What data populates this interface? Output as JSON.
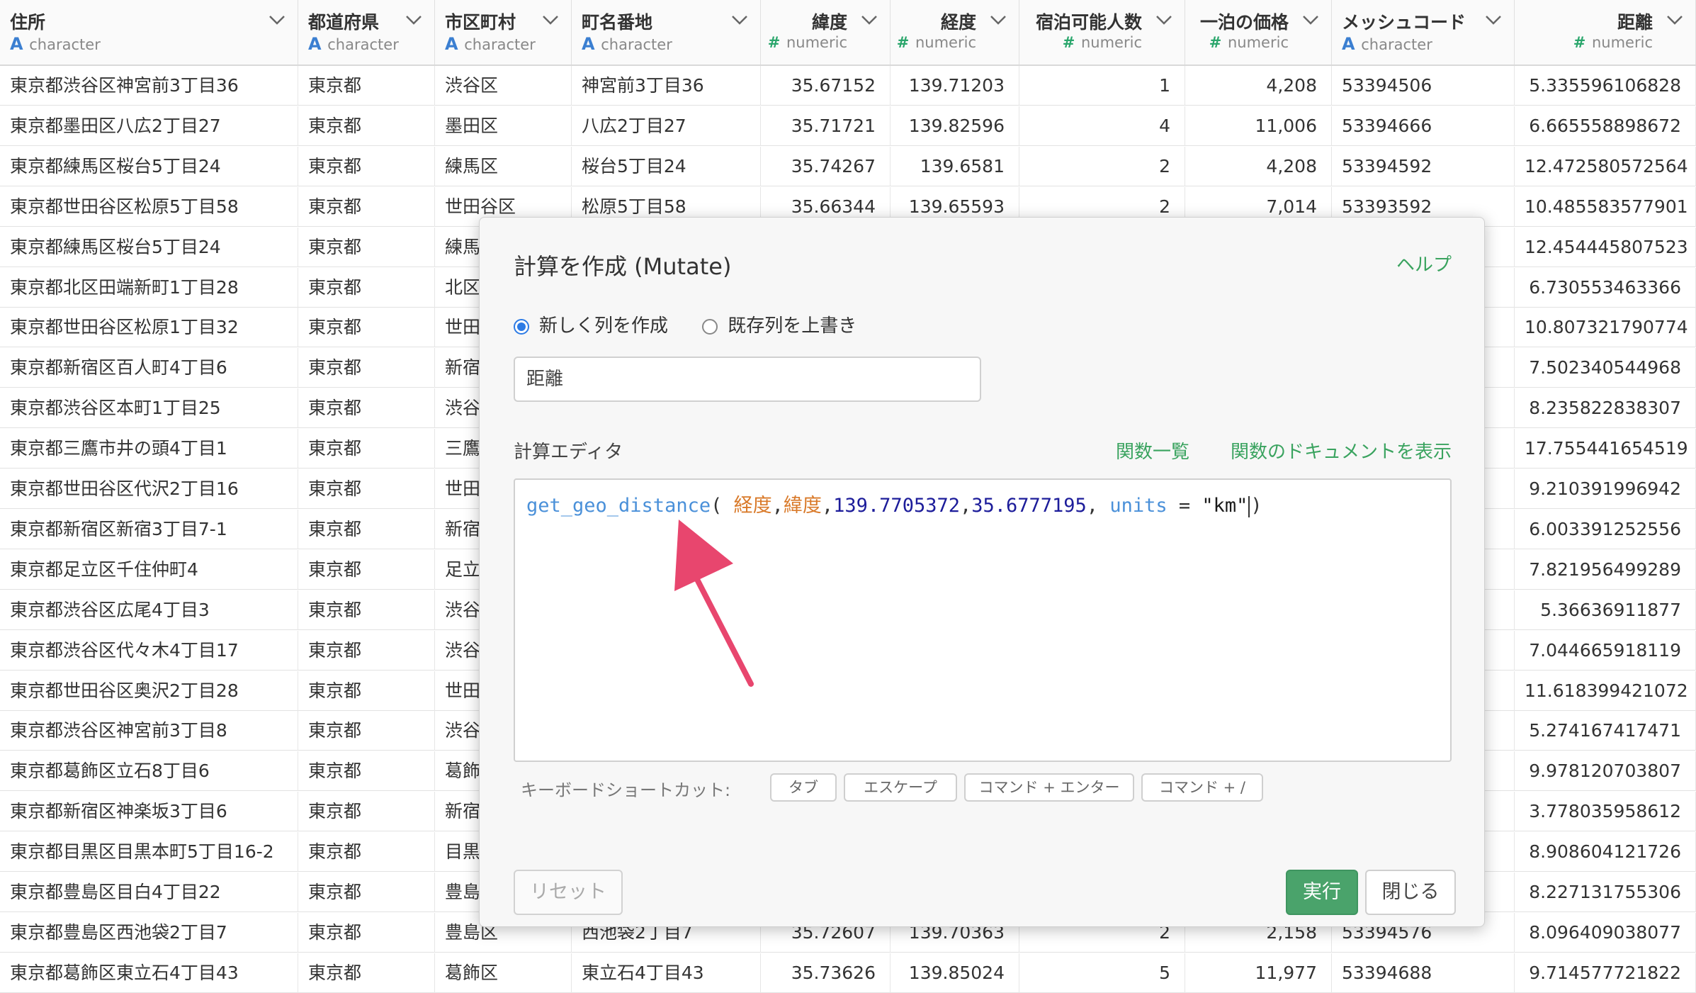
{
  "columns": [
    {
      "name": "住所",
      "type": "character"
    },
    {
      "name": "都道府県",
      "type": "character"
    },
    {
      "name": "市区町村",
      "type": "character"
    },
    {
      "name": "町名番地",
      "type": "character"
    },
    {
      "name": "緯度",
      "type": "numeric"
    },
    {
      "name": "経度",
      "type": "numeric"
    },
    {
      "name": "宿泊可能人数",
      "type": "numeric"
    },
    {
      "name": "一泊の価格",
      "type": "numeric"
    },
    {
      "name": "メッシュコード",
      "type": "character"
    },
    {
      "name": "距離",
      "type": "numeric"
    }
  ],
  "rows": [
    [
      "東京都渋谷区神宮前3丁目36",
      "東京都",
      "渋谷区",
      "神宮前3丁目36",
      "35.67152",
      "139.71203",
      "1",
      "4,208",
      "53394506",
      "5.335596106828"
    ],
    [
      "東京都墨田区八広2丁目27",
      "東京都",
      "墨田区",
      "八広2丁目27",
      "35.71721",
      "139.82596",
      "4",
      "11,006",
      "53394666",
      "6.665558898672"
    ],
    [
      "東京都練馬区桜台5丁目24",
      "東京都",
      "練馬区",
      "桜台5丁目24",
      "35.74267",
      "139.6581",
      "2",
      "4,208",
      "53394592",
      "12.472580572564"
    ],
    [
      "東京都世田谷区松原5丁目58",
      "東京都",
      "世田谷区",
      "松原5丁目58",
      "35.66344",
      "139.65593",
      "2",
      "7,014",
      "53393592",
      "10.485583577901"
    ],
    [
      "東京都練馬区桜台5丁目24",
      "東京都",
      "練馬",
      "",
      "",
      "",
      "",
      "",
      "",
      "12.454445807523"
    ],
    [
      "東京都北区田端新町1丁目28",
      "東京都",
      "北区",
      "",
      "",
      "",
      "",
      "",
      "",
      "6.730553463366"
    ],
    [
      "東京都世田谷区松原1丁目32",
      "東京都",
      "世田",
      "",
      "",
      "",
      "",
      "",
      "",
      "10.807321790774"
    ],
    [
      "東京都新宿区百人町4丁目6",
      "東京都",
      "新宿",
      "",
      "",
      "",
      "",
      "",
      "",
      "7.502340544968"
    ],
    [
      "東京都渋谷区本町1丁目25",
      "東京都",
      "渋谷",
      "",
      "",
      "",
      "",
      "",
      "",
      "8.235822838307"
    ],
    [
      "東京都三鷹市井の頭4丁目1",
      "東京都",
      "三鷹",
      "",
      "",
      "",
      "",
      "",
      "",
      "17.755441654519"
    ],
    [
      "東京都世田谷区代沢2丁目16",
      "東京都",
      "世田",
      "",
      "",
      "",
      "",
      "",
      "",
      "9.210391996942"
    ],
    [
      "東京都新宿区新宿3丁目7-1",
      "東京都",
      "新宿",
      "",
      "",
      "",
      "",
      "",
      "",
      "6.003391252556"
    ],
    [
      "東京都足立区千住仲町4",
      "東京都",
      "足立",
      "",
      "",
      "",
      "",
      "",
      "",
      "7.821956499289"
    ],
    [
      "東京都渋谷区広尾4丁目3",
      "東京都",
      "渋谷",
      "",
      "",
      "",
      "",
      "",
      "",
      "5.36636911877"
    ],
    [
      "東京都渋谷区代々木4丁目17",
      "東京都",
      "渋谷",
      "",
      "",
      "",
      "",
      "",
      "",
      "7.044665918119"
    ],
    [
      "東京都世田谷区奥沢2丁目28",
      "東京都",
      "世田",
      "",
      "",
      "",
      "",
      "",
      "",
      "11.618399421072"
    ],
    [
      "東京都渋谷区神宮前3丁目8",
      "東京都",
      "渋谷",
      "",
      "",
      "",
      "",
      "",
      "",
      "5.274167417471"
    ],
    [
      "東京都葛飾区立石8丁目6",
      "東京都",
      "葛飾",
      "",
      "",
      "",
      "",
      "",
      "",
      "9.978120703807"
    ],
    [
      "東京都新宿区神楽坂3丁目6",
      "東京都",
      "新宿",
      "",
      "",
      "",
      "",
      "",
      "",
      "3.778035958612"
    ],
    [
      "東京都目黒区目黒本町5丁目16-2",
      "東京都",
      "目黒",
      "",
      "",
      "",
      "",
      "",
      "",
      "8.908604121726"
    ],
    [
      "東京都豊島区目白4丁目22",
      "東京都",
      "豊島",
      "",
      "",
      "",
      "",
      "",
      "",
      "8.227131755306"
    ],
    [
      "東京都豊島区西池袋2丁目7",
      "東京都",
      "豊島区",
      "西池袋2丁目7",
      "35.72607",
      "139.70363",
      "2",
      "2,158",
      "53394576",
      "8.096409038077"
    ],
    [
      "東京都葛飾区東立石4丁目43",
      "東京都",
      "葛飾区",
      "東立石4丁目43",
      "35.73626",
      "139.85024",
      "5",
      "11,977",
      "53394688",
      "9.714577721822"
    ]
  ],
  "modal": {
    "title": "計算を作成 (Mutate)",
    "help": "ヘルプ",
    "radio_new": "新しく列を作成",
    "radio_overwrite": "既存列を上書き",
    "column_name_value": "距離",
    "editor_label": "計算エディタ",
    "function_list": "関数一覧",
    "function_docs": "関数のドキュメントを表示",
    "code": {
      "fn": "get_geo_distance",
      "open": "(",
      "arg1": "経度",
      "comma": ",",
      "arg2": "緯度",
      "num1": "139.7705372",
      "num2": "35.6777195",
      "comma_space": ", ",
      "kw": "units",
      "eq": " = ",
      "str": "\"km\"",
      "close": ")"
    },
    "shortcuts_label": "キーボードショートカット:",
    "shortcuts": [
      "タブ",
      "エスケープ",
      "コマンド + エンター",
      "コマンド + /"
    ],
    "reset": "リセット",
    "run": "実行",
    "close": "閉じる"
  },
  "colors": {
    "accent_green": "#4aa36b",
    "arrow": "#e8466e",
    "char_type": "#3b7fd1",
    "num_type": "#2aa66c"
  }
}
